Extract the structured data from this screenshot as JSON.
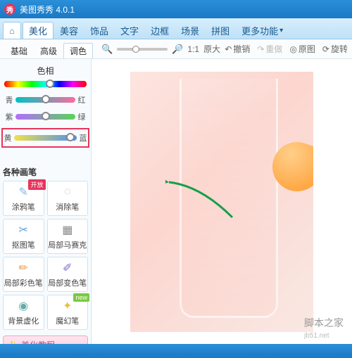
{
  "titlebar": {
    "app_name": "美图秀秀 4.0.1"
  },
  "maintabs": {
    "items": [
      "美化",
      "美容",
      "饰品",
      "文字",
      "边框",
      "场景",
      "拼图",
      "更多功能"
    ],
    "active_index": 0
  },
  "subtabs": {
    "items": [
      "基础",
      "高级",
      "调色"
    ],
    "active_index": 2
  },
  "zoom": {
    "ratio_label": "1:1",
    "zoom_mode": "原大"
  },
  "toolbar_right": {
    "undo": "撤销",
    "redo": "重做",
    "orig": "原图",
    "rotate": "旋转"
  },
  "color_sliders": {
    "title": "色相",
    "rows": [
      {
        "left": "青",
        "right": "红",
        "gradient": [
          "#00c2c2",
          "#ff6aa0"
        ],
        "thumb_pct": 50
      },
      {
        "left": "紫",
        "right": "绿",
        "gradient": [
          "#b46cff",
          "#5ad35a"
        ],
        "thumb_pct": 50
      },
      {
        "left": "黄",
        "right": "蓝",
        "gradient": [
          "#f0e04a",
          "#4a90f0"
        ],
        "thumb_pct": 90,
        "highlight": true
      }
    ]
  },
  "brush_section": {
    "title": "各种画笔",
    "items": [
      {
        "label": "涂鸦笔",
        "icon": "✎",
        "color": "#7ab8e8",
        "badge": {
          "text": "开放",
          "cls": "red"
        }
      },
      {
        "label": "消除笔",
        "icon": "◌",
        "color": "#e6a0c2"
      },
      {
        "label": "抠图笔",
        "icon": "✂",
        "color": "#5aa0e0"
      },
      {
        "label": "局部马赛克",
        "icon": "▦",
        "color": "#888"
      },
      {
        "label": "局部彩色笔",
        "icon": "✏",
        "color": "#e89a4a"
      },
      {
        "label": "局部变色笔",
        "icon": "✐",
        "color": "#7a6ad0"
      },
      {
        "label": "背景虚化",
        "icon": "◉",
        "color": "#6aa"
      },
      {
        "label": "魔幻笔",
        "icon": "✦",
        "color": "#e8c040",
        "badge": {
          "text": "new",
          "cls": "green"
        }
      }
    ]
  },
  "tutorial_button": "美化教程",
  "watermark": "脚本之家",
  "watermark_url": "jb51.net"
}
